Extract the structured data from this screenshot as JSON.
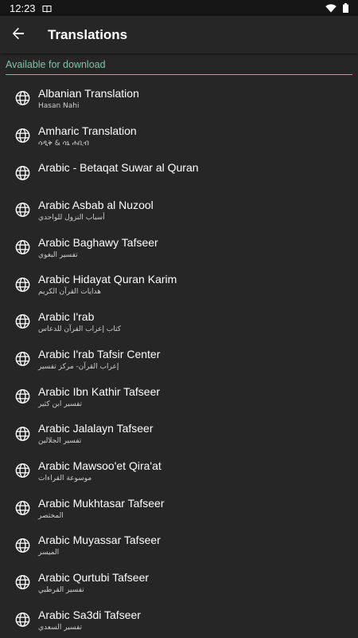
{
  "status_bar": {
    "time": "12:23",
    "icons": [
      "book-icon",
      "wifi-icon",
      "battery-icon"
    ]
  },
  "header": {
    "back_icon": "arrow-left-icon",
    "title": "Translations"
  },
  "section": {
    "title": "Available for download"
  },
  "colors": {
    "background": "#262626",
    "status_bar": "#161616",
    "accent": "#82c2a8",
    "text": "#ffffff"
  },
  "items": [
    {
      "title": "Albanian Translation",
      "subtitle": "Hasan Nahi",
      "icon": "globe-icon"
    },
    {
      "title": "Amharic Translation",
      "subtitle": "ሳዲቅ & ሳኒ ሐቢብ",
      "icon": "globe-icon"
    },
    {
      "title": "Arabic - Betaqat Suwar al Quran",
      "subtitle": "",
      "icon": "globe-icon"
    },
    {
      "title": "Arabic Asbab al Nuzool",
      "subtitle": "أسباب النزول للواحدي",
      "icon": "globe-icon"
    },
    {
      "title": "Arabic Baghawy Tafseer",
      "subtitle": "تفسير البغوي",
      "icon": "globe-icon"
    },
    {
      "title": "Arabic Hidayat Quran Karim",
      "subtitle": "هدايات القرآن الكريم",
      "icon": "globe-icon"
    },
    {
      "title": "Arabic I'rab",
      "subtitle": "كتاب إعراب القرآن للدعاس",
      "icon": "globe-icon"
    },
    {
      "title": "Arabic I'rab Tafsir Center",
      "subtitle": "إعراب القرآن- مركز تفسير",
      "icon": "globe-icon"
    },
    {
      "title": "Arabic Ibn Kathir Tafseer",
      "subtitle": "تفسير ابن كثير",
      "icon": "globe-icon"
    },
    {
      "title": "Arabic Jalalayn Tafseer",
      "subtitle": "تفسير الجلالين",
      "icon": "globe-icon"
    },
    {
      "title": "Arabic Mawsoo'et Qira'at",
      "subtitle": "موسوعة القراءات",
      "icon": "globe-icon"
    },
    {
      "title": "Arabic Mukhtasar Tafseer",
      "subtitle": "المختصر",
      "icon": "globe-icon"
    },
    {
      "title": "Arabic Muyassar Tafseer",
      "subtitle": "الميسر",
      "icon": "globe-icon"
    },
    {
      "title": "Arabic Qurtubi Tafseer",
      "subtitle": "تفسير القرطبي",
      "icon": "globe-icon"
    },
    {
      "title": "Arabic Sa3di Tafseer",
      "subtitle": "تفسير السعدي",
      "icon": "globe-icon"
    }
  ]
}
